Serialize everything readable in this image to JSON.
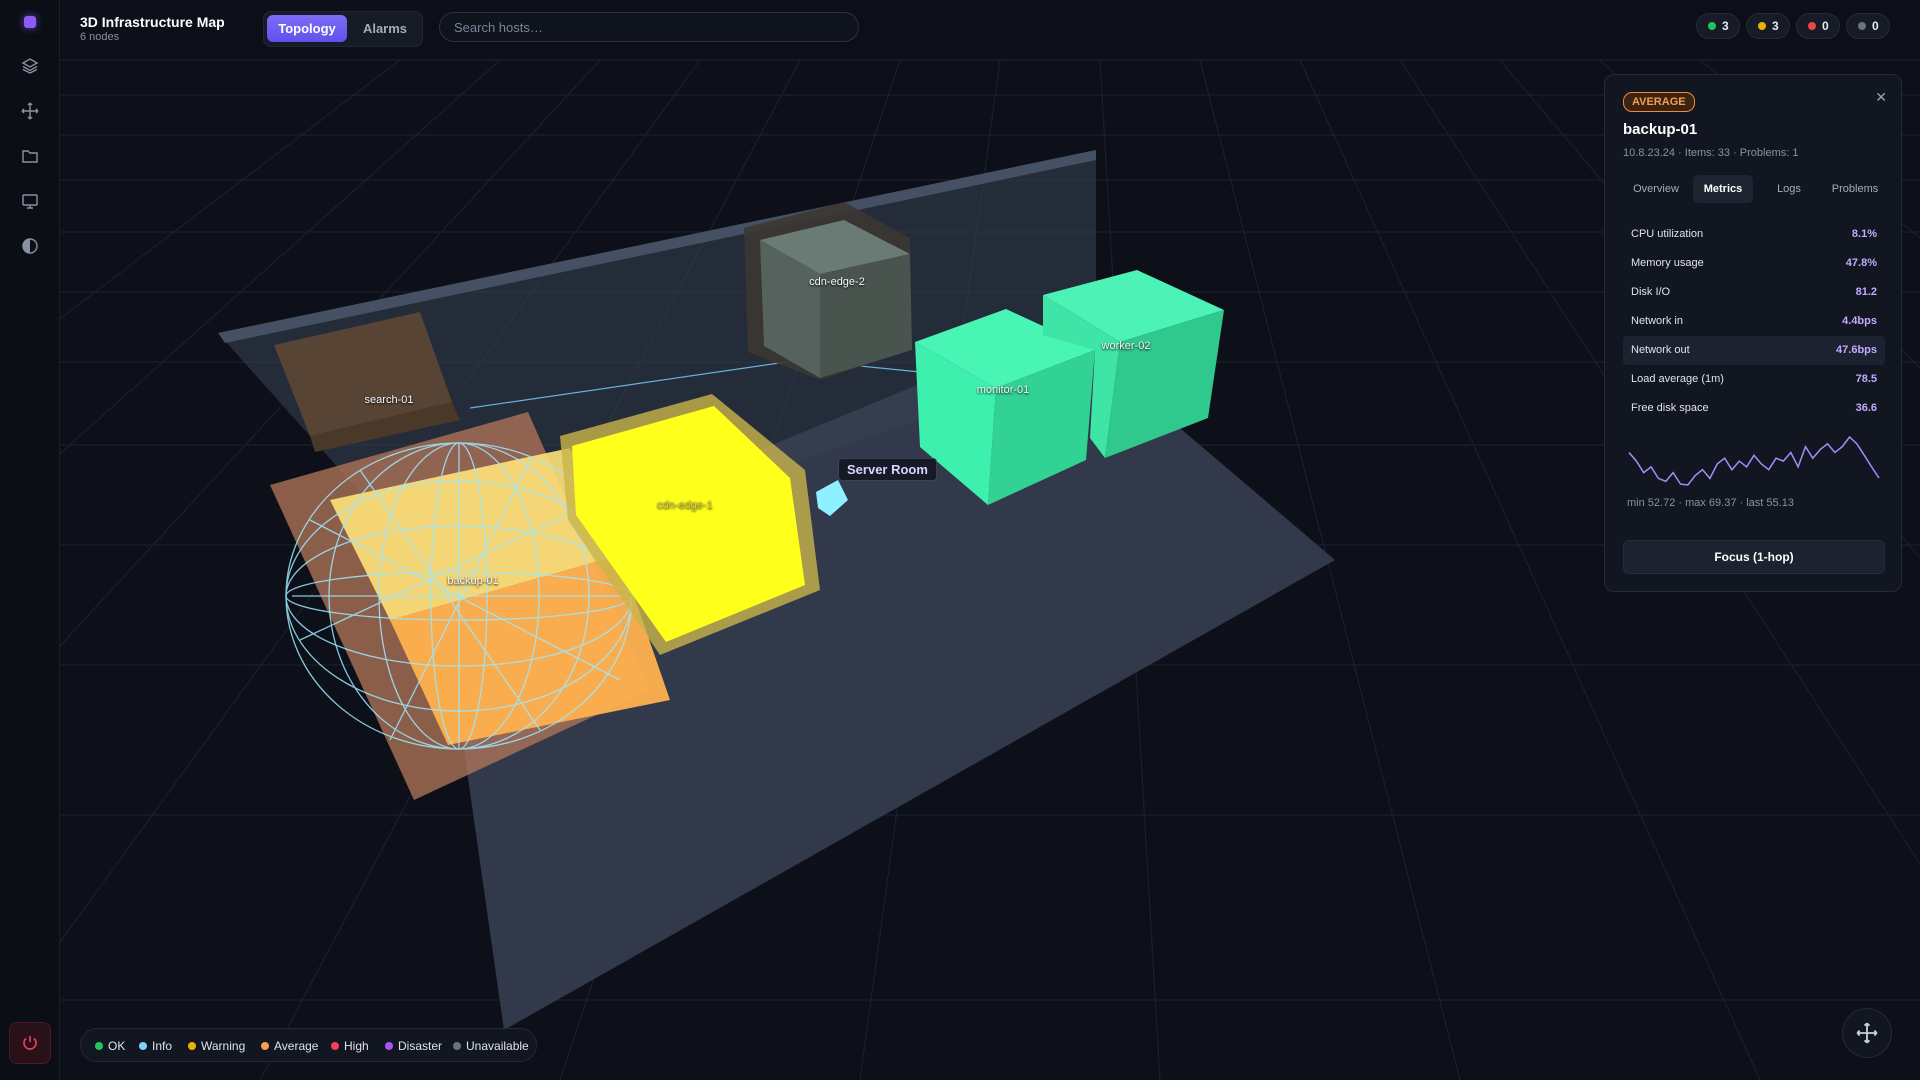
{
  "app": {
    "title": "3D Infrastructure Map",
    "subtitle": "6 nodes"
  },
  "view_tabs": [
    {
      "label": "Topology",
      "active": true
    },
    {
      "label": "Alarms",
      "active": false
    }
  ],
  "search": {
    "placeholder": "Search hosts…",
    "value": ""
  },
  "status_counters": [
    {
      "name": "ok",
      "color": "#22c55e",
      "count": "3"
    },
    {
      "name": "warning",
      "color": "#eab308",
      "count": "3"
    },
    {
      "name": "high",
      "color": "#ef4444",
      "count": "0"
    },
    {
      "name": "unavailable",
      "color": "#6b7280",
      "count": "0"
    }
  ],
  "sidebar": {
    "icons": [
      "layers-icon",
      "move-icon",
      "folder-icon",
      "monitor-icon",
      "contrast-icon"
    ],
    "power_icon": "power-icon"
  },
  "scene": {
    "group_label": "Server Room",
    "nodes": [
      {
        "name": "search-01",
        "status": "average",
        "color": "#7a5a3a"
      },
      {
        "name": "cdn-edge-2",
        "status": "unavailable",
        "color": "#5f6a66"
      },
      {
        "name": "monitor-01",
        "status": "ok",
        "color": "#3ef0ad"
      },
      {
        "name": "worker-02",
        "status": "ok",
        "color": "#3ef0ad"
      },
      {
        "name": "cdn-edge-1",
        "status": "warning",
        "color": "#ffff1a"
      },
      {
        "name": "backup-01",
        "status": "average",
        "color": "#ffb45a",
        "selected": true
      }
    ]
  },
  "detail": {
    "severity": "AVERAGE",
    "host": "backup-01",
    "meta": "10.8.23.24 · Items: 33 · Problems: 1",
    "tabs": [
      {
        "label": "Overview",
        "active": false
      },
      {
        "label": "Metrics",
        "active": true
      },
      {
        "label": "Logs",
        "active": false
      },
      {
        "label": "Problems",
        "active": false
      }
    ],
    "metrics": [
      {
        "label": "CPU utilization",
        "value": "8.1%"
      },
      {
        "label": "Memory usage",
        "value": "47.8%"
      },
      {
        "label": "Disk I/O",
        "value": "81.2"
      },
      {
        "label": "Network in",
        "value": "4.4bps"
      },
      {
        "label": "Network out",
        "value": "47.6bps",
        "highlighted": true
      },
      {
        "label": "Load average (1m)",
        "value": "78.5"
      },
      {
        "label": "Free disk space",
        "value": "36.6"
      }
    ],
    "sparkline": {
      "values": [
        64,
        61,
        57,
        59,
        55,
        54,
        57,
        53,
        52.7,
        56,
        58,
        55,
        60,
        62,
        58,
        61,
        59,
        63,
        60,
        58,
        62,
        61,
        64,
        59,
        66,
        62,
        65,
        67,
        64,
        66,
        69.37,
        67,
        63,
        59,
        55.13
      ],
      "min": 52.72,
      "max": 69.37,
      "last": 55.13,
      "color": "#a78bfa"
    },
    "caption": "min 52.72 · max 69.37 · last 55.13",
    "focus_button": "Focus (1-hop)",
    "close_icon": "close-icon"
  },
  "legend": [
    {
      "label": "OK",
      "color": "#22c55e"
    },
    {
      "label": "Info",
      "color": "#7dd3fc"
    },
    {
      "label": "Warning",
      "color": "#eab308"
    },
    {
      "label": "Average",
      "color": "#f59e4b"
    },
    {
      "label": "High",
      "color": "#f43f5e"
    },
    {
      "label": "Disaster",
      "color": "#a855f7"
    },
    {
      "label": "Unavailable",
      "color": "#6b7280"
    }
  ]
}
